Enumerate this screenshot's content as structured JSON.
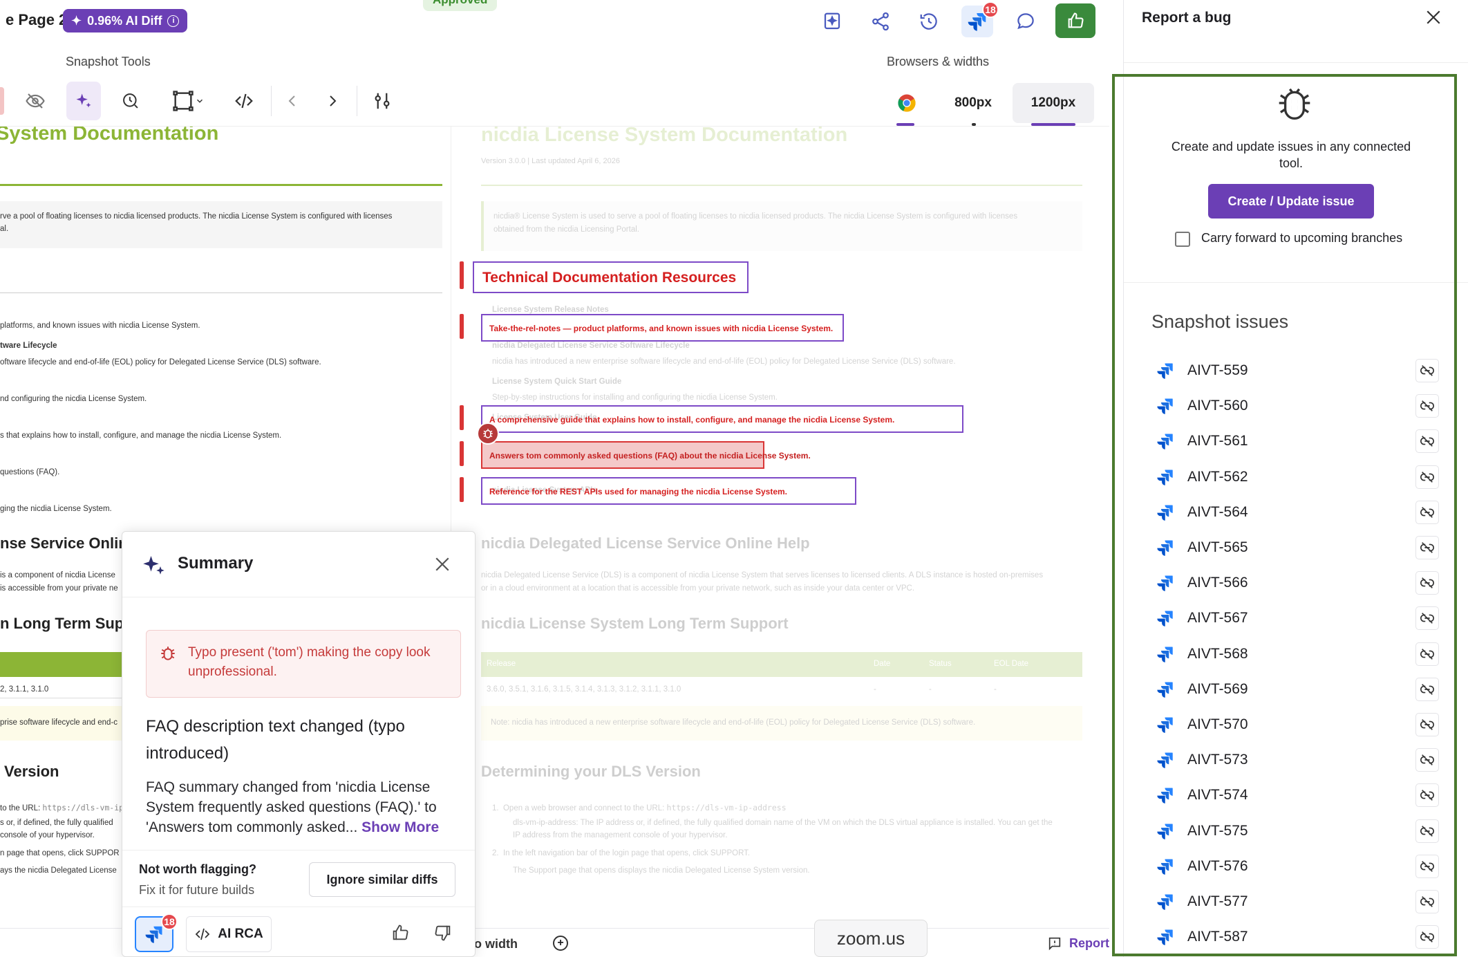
{
  "header": {
    "page_title": "e Page 2",
    "ai_diff_label": "0.96% AI Diff",
    "approved_label": "Approved",
    "jira_badge_count": "18",
    "snapshot_tools_label": "Snapshot Tools",
    "browsers_widths_label": "Browsers & widths",
    "widths": [
      "800px",
      "1200px"
    ]
  },
  "base_doc": {
    "title": "System Documentation",
    "intro": "rve a pool of floating licenses to nicdia licensed products. The nicdia License System is configured with licenses",
    "intro2": "al.",
    "lines": [
      "platforms, and known issues with nicdia License System.",
      "tware Lifecycle",
      "oftware lifecycle and end-of-life (EOL) policy for Delegated License Service (DLS) software.",
      "nd configuring the nicdia License System.",
      "s that explains how to install, configure, and manage the nicdia License System.",
      "questions (FAQ).",
      "ging the nicdia License System."
    ],
    "h_dls": "nse Service Onlin",
    "dls_1": "is a component of nicdia License",
    "dls_2": "is accessible from your private ne",
    "h_lts": "n Long Term Supp",
    "lts_row": "2, 3.1.1, 3.1.0",
    "lts_note": "prise software lifecycle and end-c",
    "h_version": "Version",
    "v1": "to the URL:",
    "v1_code": "https://dls-vm-ip",
    "v2": "s or, if defined, the fully qualified",
    "v3": "console of your hypervisor.",
    "v4": "n page that opens, click SUPPOR",
    "v5": "ays the nicdia Delegated License"
  },
  "head_doc": {
    "title": "nicdia License System Documentation",
    "subtitle": "Version 3.0.0 | Last updated April 6, 2026",
    "intro": "nicdia® License System is used to serve a pool of floating licenses to nicdia licensed products. The nicdia License System is configured with licenses",
    "intro2": "obtained from the nicdia Licensing Portal.",
    "resources_heading": "Technical Documentation Resources",
    "items": [
      {
        "title": "License System Release Notes",
        "desc": "Take-the-rel-notes — product platforms, and known issues with nicdia License System."
      },
      {
        "title": "nicdia Delegated License Service Software Lifecycle",
        "desc": "nicdia has introduced a new enterprise software lifecycle and end-of-life (EOL) policy for Delegated License Service (DLS) software."
      },
      {
        "title": "License System Quick Start Guide",
        "desc": "Step-by-step instructions for installing and configuring the nicdia License System."
      },
      {
        "title": "License System User Guide",
        "desc": "A comprehensive guide that explains how to install, configure, and manage the nicdia License System."
      },
      {
        "title": "License System FAQ",
        "desc": "Answers tom commonly asked questions (FAQ) about the nicdia License System."
      },
      {
        "title": "nicdia License System APIs",
        "desc": "Reference for the REST APIs used for managing the nicdia License System."
      }
    ],
    "h_dls": "nicdia Delegated License Service Online Help",
    "dls_1": "nicdia Delegated License Service (DLS) is a component of nicdia License System that serves licenses to licensed clients. A DLS instance is hosted on-premises",
    "dls_2": "or in a cloud environment at a location that is accessible from your private network, such as inside your data center or VPC.",
    "h_lts": "nicdia License System Long Term Support",
    "table_headers": [
      "Release",
      "Date",
      "Status",
      "EOL Date"
    ],
    "table_row": [
      "3.6.0, 3.5.1, 3.1.6, 3.1.5, 3.1.4, 3.1.3, 3.1.2, 3.1.1, 3.1.0",
      "-",
      "-",
      "-"
    ],
    "lts_note": "Note: nicdia has introduced a new enterprise software lifecycle and end-of-life (EOL) policy for Delegated License Service (DLS) software.",
    "h_version": "Determining your DLS Version",
    "steps": [
      "Open a web browser and connect to the URL:",
      "dls-vm-ip-address: The IP address or, if defined, the fully qualified domain name of the VM on which the DLS virtual appliance is installed. You can get the",
      "IP address from the management console of your hypervisor.",
      "In the left navigation bar of the login page that opens, click SUPPORT.",
      "The Support page that opens displays the nicdia Delegated License System version."
    ],
    "step_code": "https://dls-vm-ip-address"
  },
  "summary": {
    "title": "Summary",
    "alert": "Typo present ('tom') making the copy look unprofessional.",
    "heading": "FAQ description text changed (typo introduced)",
    "body": "FAQ summary changed from 'nicdia License System frequently asked questions (FAQ).' to 'Answers tom commonly asked...",
    "show_more": "Show More",
    "not_worth": "Not worth flagging?",
    "fix_future": "Fix it for future builds",
    "ignore_btn": "Ignore similar diffs",
    "rca_label": "AI RCA",
    "jira_badge": "18"
  },
  "bottom": {
    "fit_width": "o width",
    "report": "Report",
    "zoom_pill": "zoom.us"
  },
  "right_panel": {
    "title": "Report a bug",
    "description": "Create and update issues in any connected tool.",
    "create_btn": "Create / Update issue",
    "carry_forward": "Carry forward to upcoming branches",
    "snapshot_issues_title": "Snapshot issues",
    "issues": [
      "AIVT-559",
      "AIVT-560",
      "AIVT-561",
      "AIVT-562",
      "AIVT-564",
      "AIVT-565",
      "AIVT-566",
      "AIVT-567",
      "AIVT-568",
      "AIVT-569",
      "AIVT-570",
      "AIVT-573",
      "AIVT-574",
      "AIVT-575",
      "AIVT-576",
      "AIVT-577",
      "AIVT-587"
    ]
  },
  "colors": {
    "brand_purple": "#6b3fb5",
    "approve_green": "#3a8a3c",
    "diff_red": "#d93535",
    "doc_green": "#8cb536"
  }
}
